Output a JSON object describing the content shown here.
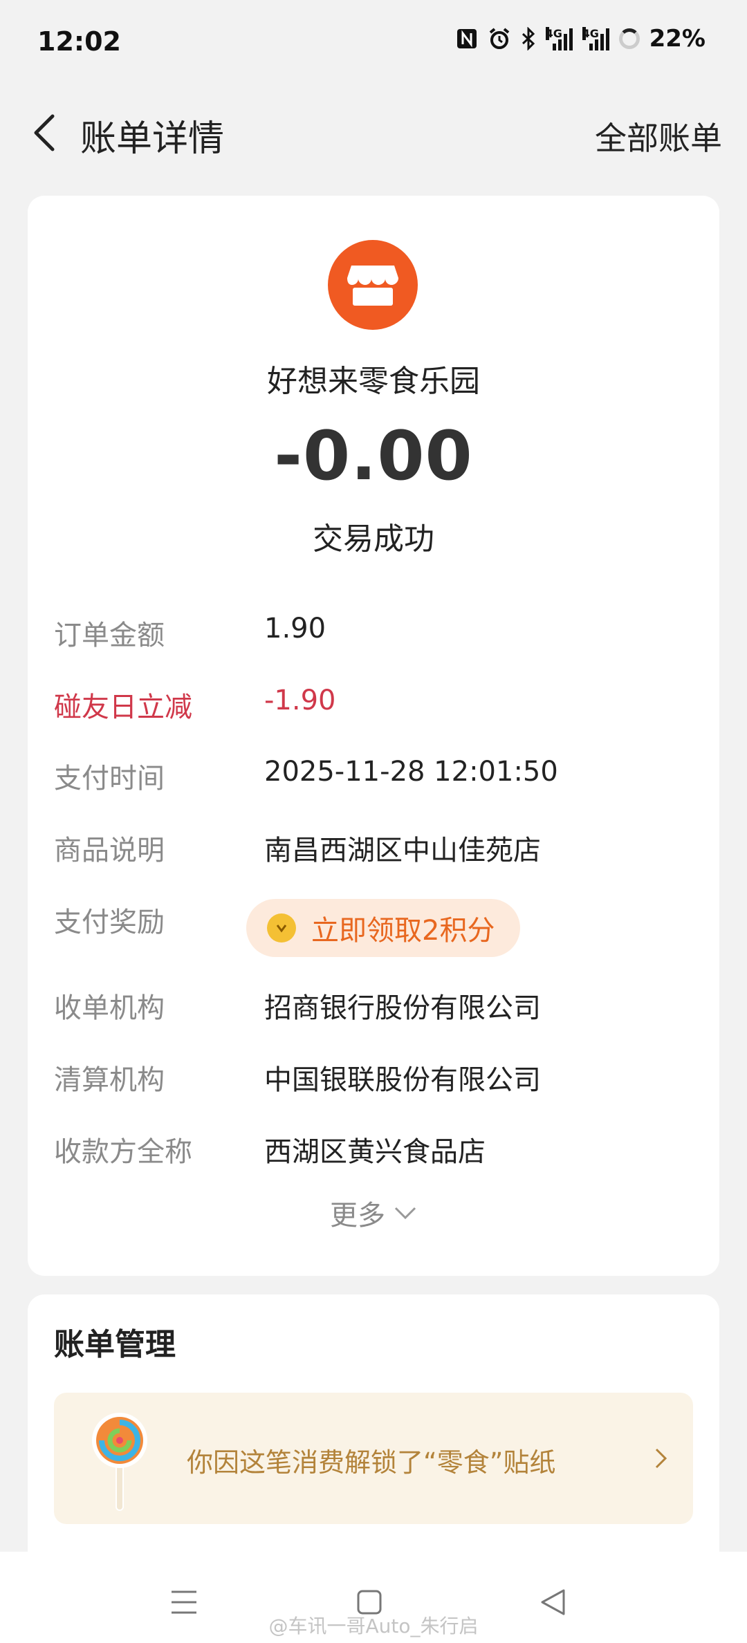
{
  "status_bar": {
    "time": "12:02",
    "battery": "22%",
    "network_1": "4G",
    "network_2": "4G",
    "icons": [
      "nfc-icon",
      "alarm-icon",
      "bluetooth-icon",
      "signal-icon",
      "signal-icon",
      "battery-ring-icon"
    ]
  },
  "header": {
    "title": "账单详情",
    "all_bills": "全部账单",
    "back_icon": "chevron-left-icon"
  },
  "merchant": {
    "name": "好想来零食乐园",
    "logo_icon": "storefront-icon",
    "logo_color": "#f05a22"
  },
  "amount": "-0.00",
  "trade_status": "交易成功",
  "details": [
    {
      "label": "订单金额",
      "value": "1.90"
    },
    {
      "label": "碰友日立减",
      "value": "-1.90"
    },
    {
      "label": "支付时间",
      "value": "2025-11-28 12:01:50"
    },
    {
      "label": "商品说明",
      "value": "南昌西湖区中山佳苑店"
    },
    {
      "label": "支付奖励",
      "value": "立即领取2积分"
    },
    {
      "label": "收单机构",
      "value": "招商银行股份有限公司"
    },
    {
      "label": "清算机构",
      "value": "中国银联股份有限公司"
    },
    {
      "label": "收款方全称",
      "value": "西湖区黄兴食品店"
    }
  ],
  "more_label": "更多",
  "bill_management": {
    "title": "账单管理",
    "sticker_text": "你因这笔消费解锁了“零食”贴纸"
  },
  "watermark": "@车讯一哥Auto_朱行启",
  "colors": {
    "accent": "#f05a22",
    "discount_red": "#d0384a",
    "reward_orange": "#e8671f",
    "sticker_gold": "#b3833a"
  }
}
